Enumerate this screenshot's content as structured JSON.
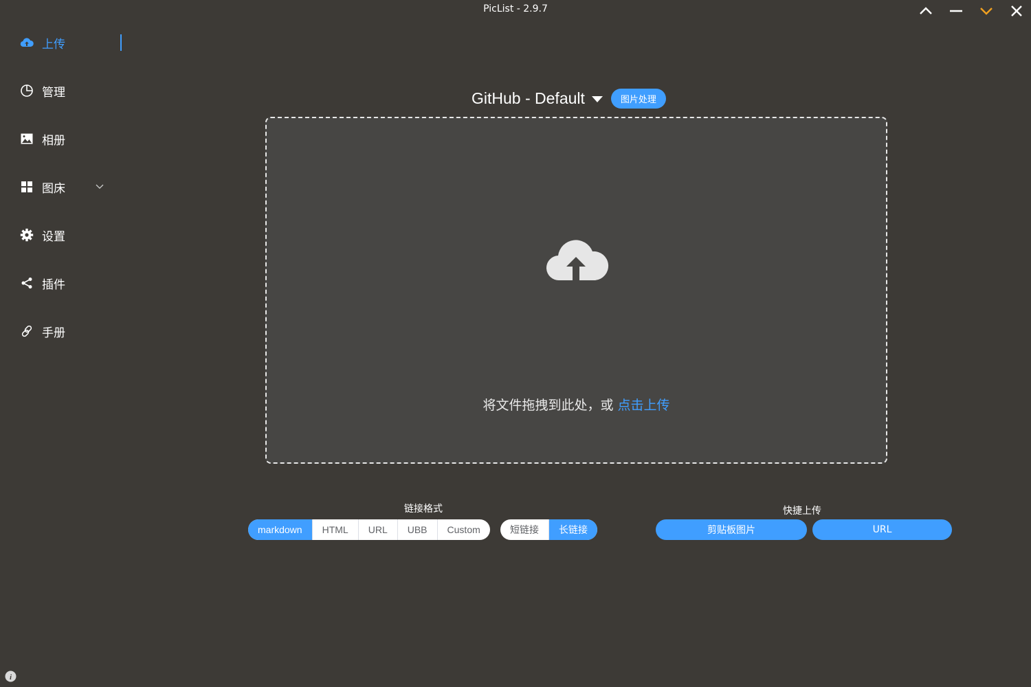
{
  "window": {
    "title": "PicList - 2.9.7",
    "controls": [
      "chevron-up-icon",
      "minimize-icon",
      "chevron-down-icon",
      "close-icon"
    ]
  },
  "sidebar": {
    "items": [
      {
        "label": "上传",
        "icon": "cloud-upload-icon",
        "active": true
      },
      {
        "label": "管理",
        "icon": "pie-chart-icon"
      },
      {
        "label": "相册",
        "icon": "image-icon"
      },
      {
        "label": "图床",
        "icon": "grid-icon",
        "expandable": true
      },
      {
        "label": "设置",
        "icon": "gear-icon"
      },
      {
        "label": "插件",
        "icon": "share-icon"
      },
      {
        "label": "手册",
        "icon": "link-icon"
      }
    ]
  },
  "upload": {
    "picbed_name": "GitHub - Default",
    "image_process_label": "图片处理",
    "drop_text": "将文件拖拽到此处，或 ",
    "drop_link": "点击上传"
  },
  "link_format": {
    "title": "链接格式",
    "options": [
      "markdown",
      "HTML",
      "URL",
      "UBB",
      "Custom"
    ],
    "selected": "markdown",
    "length_options": [
      "短链接",
      "长链接"
    ],
    "length_selected": "长链接"
  },
  "quick_upload": {
    "title": "快捷上传",
    "buttons": [
      "剪贴板图片",
      "URL"
    ]
  },
  "colors": {
    "background": "#3d3a36",
    "accent": "#409eff",
    "dropzone": "#474644",
    "minimize_highlight": "#f0a020"
  }
}
